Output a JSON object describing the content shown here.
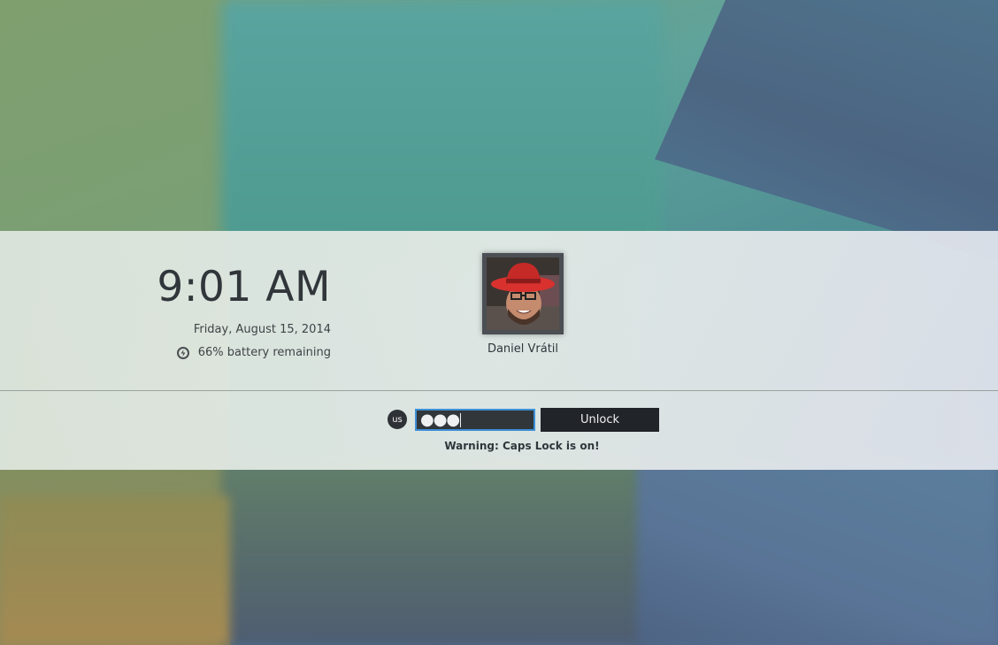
{
  "clock": {
    "time": "9:01 AM",
    "date": "Friday, August 15, 2014"
  },
  "battery": {
    "text": "66% battery remaining",
    "percent": 66,
    "icon": "battery-icon"
  },
  "user": {
    "name": "Daniel Vrátil",
    "avatar_icon": "user-avatar"
  },
  "keyboard_layout": {
    "label": "us"
  },
  "password_field": {
    "value": "●●●",
    "masked_length": 3
  },
  "unlock_button": {
    "label": "Unlock"
  },
  "warning": {
    "text": "Warning: Caps Lock is on!"
  },
  "colors": {
    "accent": "#3d8fd6",
    "button": "#212529",
    "text": "#31363b"
  }
}
